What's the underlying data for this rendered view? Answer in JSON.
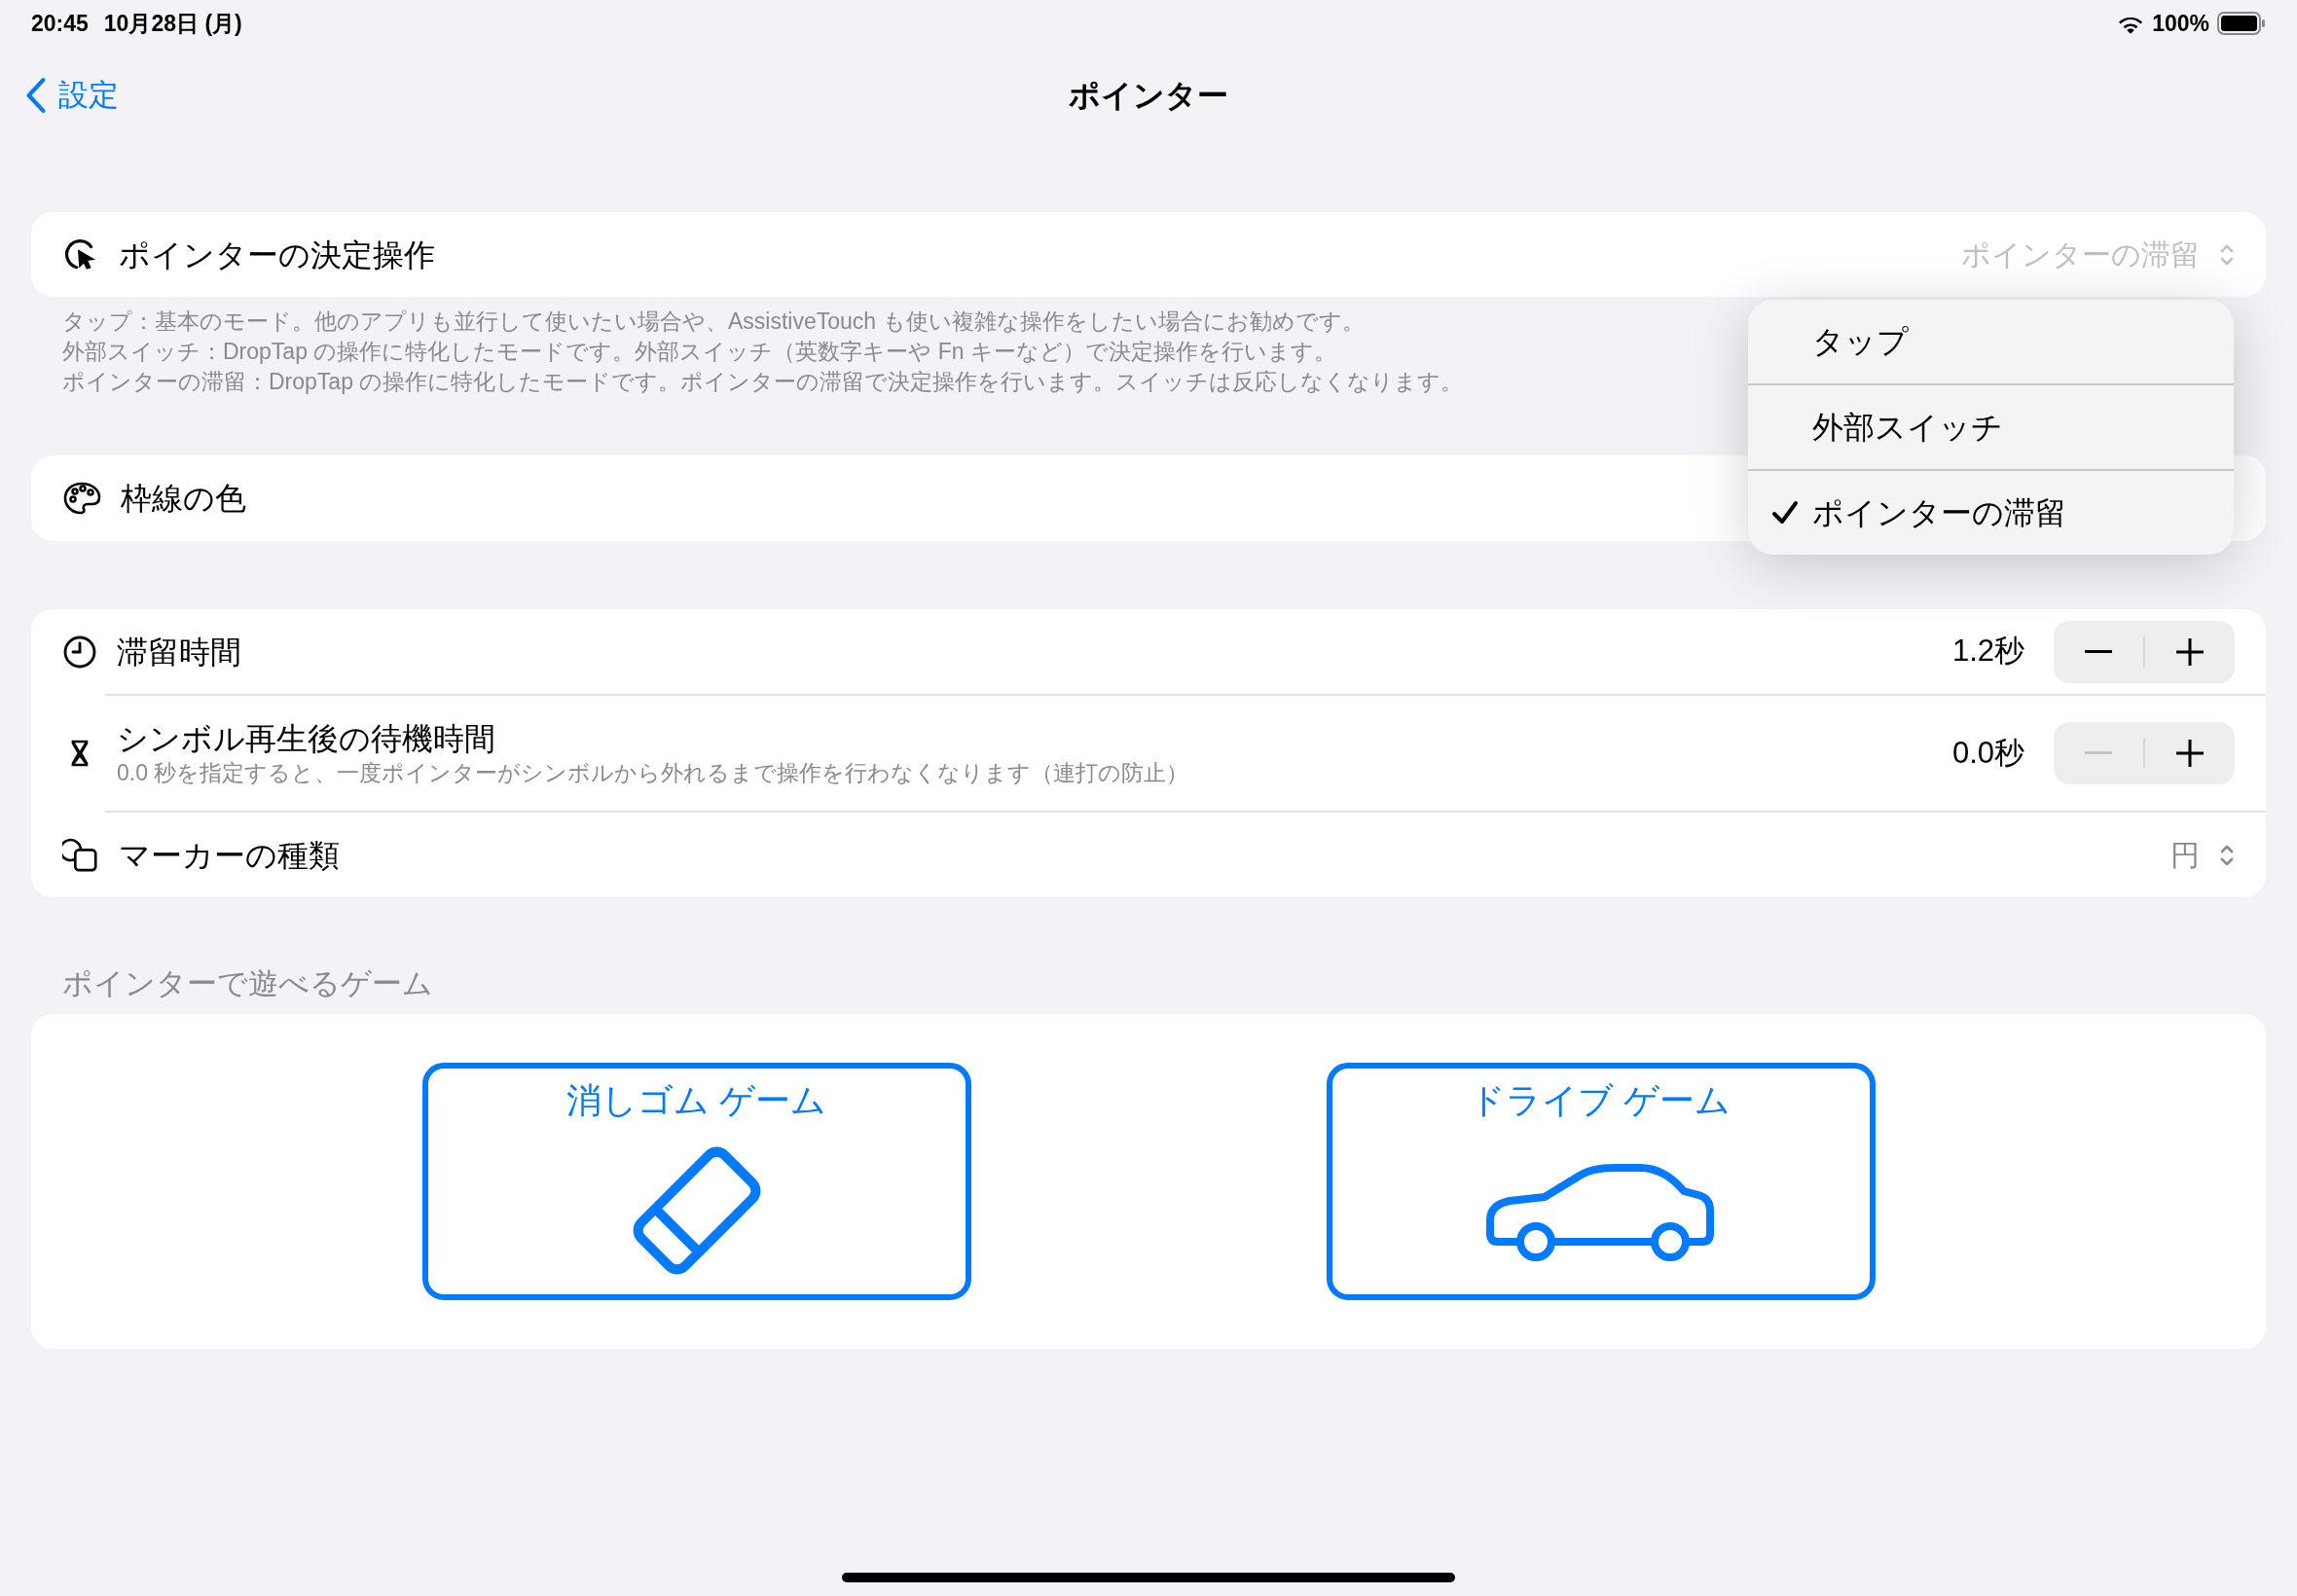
{
  "status_bar": {
    "time": "20:45",
    "date": "10月28日 (月)",
    "battery": "100%"
  },
  "nav": {
    "back": "設定",
    "title": "ポインター"
  },
  "click_action": {
    "label": "ポインターの決定操作",
    "value": "ポインターの滞留",
    "descriptions": [
      "タップ：基本のモード。他のアプリも並行して使いたい場合や、AssistiveTouch も使い複雑な操作をしたい場合にお勧めです。",
      "外部スイッチ：DropTap の操作に特化したモードです。外部スイッチ（英数字キーや Fn キーなど）で決定操作を行います。",
      "ポインターの滞留：DropTap の操作に特化したモードです。ポインターの滞留で決定操作を行います。スイッチは反応しなくなります。"
    ]
  },
  "border_color": {
    "label": "枠線の色"
  },
  "settings": [
    {
      "kind": "stepper",
      "label": "滞留時間",
      "value": "1.2秒",
      "decrement_disabled": false
    },
    {
      "kind": "stepper",
      "label": "シンボル再生後の待機時間",
      "subtitle": "0.0 秒を指定すると、一度ポインターがシンボルから外れるまで操作を行わなくなります（連打の防止）",
      "value": "0.0秒",
      "decrement_disabled": true
    },
    {
      "kind": "picker",
      "label": "マーカーの種類",
      "value": "円"
    }
  ],
  "games_header": "ポインターで遊べるゲーム",
  "games": [
    {
      "kind": "eraser",
      "label": "消しゴム ゲーム"
    },
    {
      "kind": "car",
      "label": "ドライブ ゲーム"
    }
  ],
  "menu": {
    "items": [
      {
        "label": "タップ",
        "selected": false
      },
      {
        "label": "外部スイッチ",
        "selected": false
      },
      {
        "label": "ポインターの滞留",
        "selected": true
      }
    ]
  }
}
